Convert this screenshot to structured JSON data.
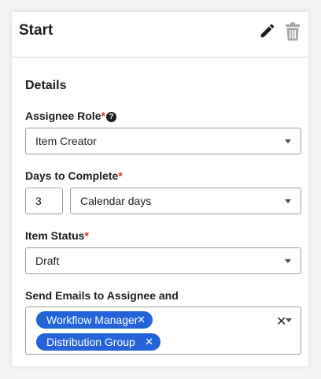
{
  "header": {
    "title": "Start",
    "edit_icon": "pencil-icon",
    "delete_icon": "trash-icon"
  },
  "details": {
    "title": "Details",
    "assignee_role": {
      "label": "Assignee Role",
      "required_mark": "*",
      "help_icon": "?",
      "value": "Item Creator"
    },
    "days_to_complete": {
      "label": "Days to Complete",
      "required_mark": "*",
      "number": "3",
      "unit": "Calendar days"
    },
    "item_status": {
      "label": "Item Status",
      "required_mark": "*",
      "value": "Draft"
    },
    "send_emails": {
      "label": "Send Emails to Assignee and",
      "chips": [
        "Workflow Manager",
        "Distribution Group"
      ],
      "chip_remove": "✕",
      "clear": "✕"
    }
  },
  "colors": {
    "chip_background": "#2563d9",
    "required": "#d32f2f"
  }
}
